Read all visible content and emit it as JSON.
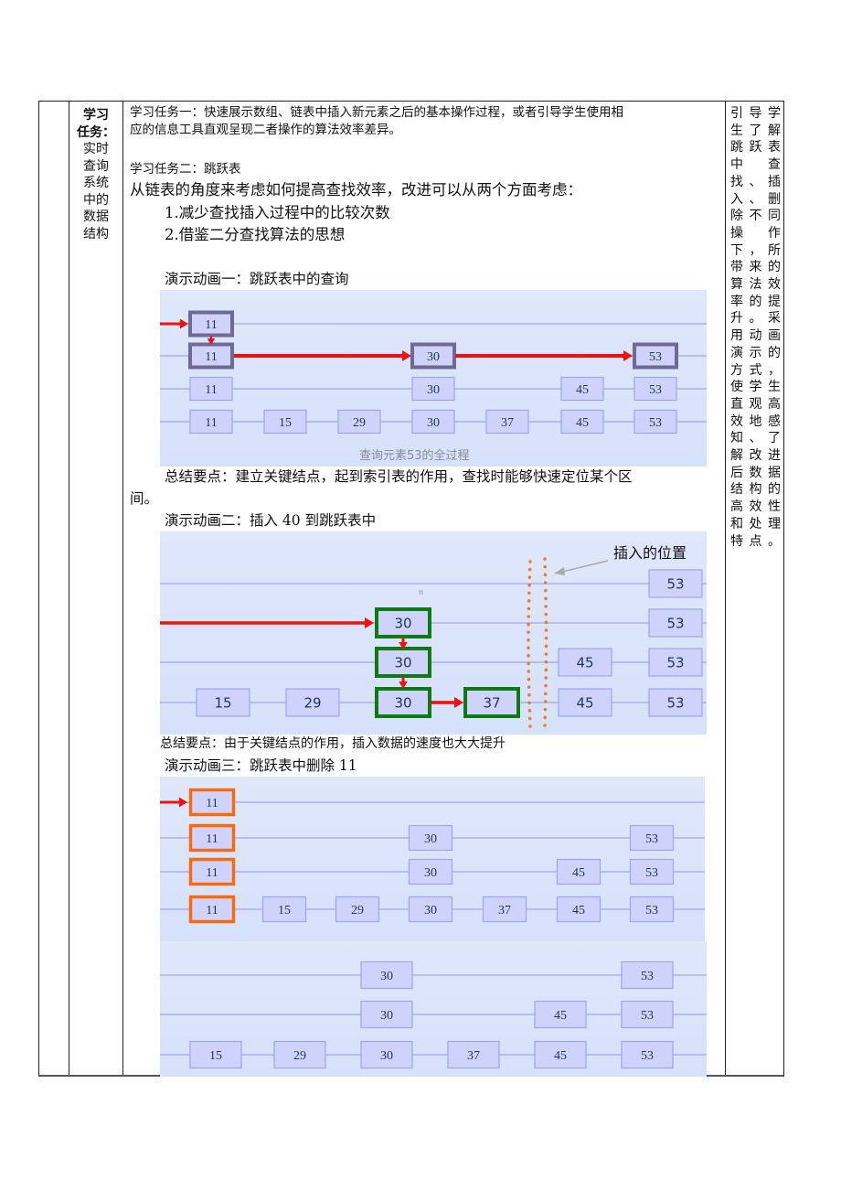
{
  "left_column": {
    "heading": "学习任务：",
    "heading_lines": [
      "学习",
      "任务："
    ],
    "subject_lines": [
      "实时",
      "查询",
      "系统",
      "中的",
      "数据",
      "结构"
    ]
  },
  "main": {
    "task1_line1": "学习任务一：快速展示数组、链表中插入新元素之后的基本操作过程，或者引导学生使用相",
    "task1_line2": "应的信息工具直观呈现二者操作的算法效率差异。",
    "task2_title": "学习任务二：跳跃表",
    "intro": "从链表的角度来考虑如何提高查找效率，改进可以从两个方面考虑：",
    "points": [
      "1.减少查找插入过程中的比较次数",
      "2.借鉴二分查找算法的思想"
    ],
    "demo1": {
      "title": "演示动画一：跳跃表中的查询",
      "caption": "查询元素53的全过程",
      "levels": [
        [
          "11"
        ],
        [
          "11",
          "30",
          "53"
        ],
        [
          "11",
          "30",
          "45",
          "53"
        ],
        [
          "11",
          "15",
          "29",
          "30",
          "37",
          "45",
          "53"
        ]
      ],
      "summary_line1": "总结要点：建立关键结点，起到索引表的作用，查找时能够快速定位某个区",
      "summary_line2": "间。"
    },
    "demo2": {
      "title": "演示动画二：插入 40 到跳跃表中",
      "annotation": "插入的位置",
      "levels": [
        [
          "53"
        ],
        [
          "30",
          "53"
        ],
        [
          "30",
          "45",
          "53"
        ],
        [
          "15",
          "29",
          "30",
          "37",
          "45",
          "53"
        ]
      ],
      "summary": "总结要点：由于关键结点的作用，插入数据的速度也大大提升"
    },
    "demo3": {
      "title": "演示动画三：跳跃表中删除 11",
      "before_levels": [
        [
          "11"
        ],
        [
          "11",
          "30",
          "53"
        ],
        [
          "11",
          "30",
          "45",
          "53"
        ],
        [
          "11",
          "15",
          "29",
          "30",
          "37",
          "45",
          "53"
        ]
      ],
      "after_levels": [
        [
          "30",
          "53"
        ],
        [
          "30",
          "45",
          "53"
        ],
        [
          "15",
          "29",
          "30",
          "37",
          "45",
          "53"
        ]
      ]
    }
  },
  "right_column": {
    "lines": [
      "引导学",
      "生了解",
      "跳跃表",
      "中　查",
      "找、插",
      "入、删",
      "除不同",
      "操　作",
      "下，所",
      "带来的",
      "算法效",
      "率的提",
      "升。采",
      "用动画",
      "演示的",
      "方式，",
      "使学生",
      "直观高",
      "效地感",
      "知、了",
      "解改进",
      "后数据",
      "结构的",
      "高效性",
      "和处理",
      "特点。"
    ]
  },
  "colors": {
    "panel_bg": "#d9e3fb",
    "node_fill": "#cfd3fb",
    "node_border": "#9ea4f0",
    "line": "#9fa6ee",
    "search_highlight": "#6d6a96",
    "insert_highlight": "#0f7a12",
    "delete_highlight": "#f86a10",
    "arrow": "#f01010",
    "dots": "#f47a22"
  }
}
